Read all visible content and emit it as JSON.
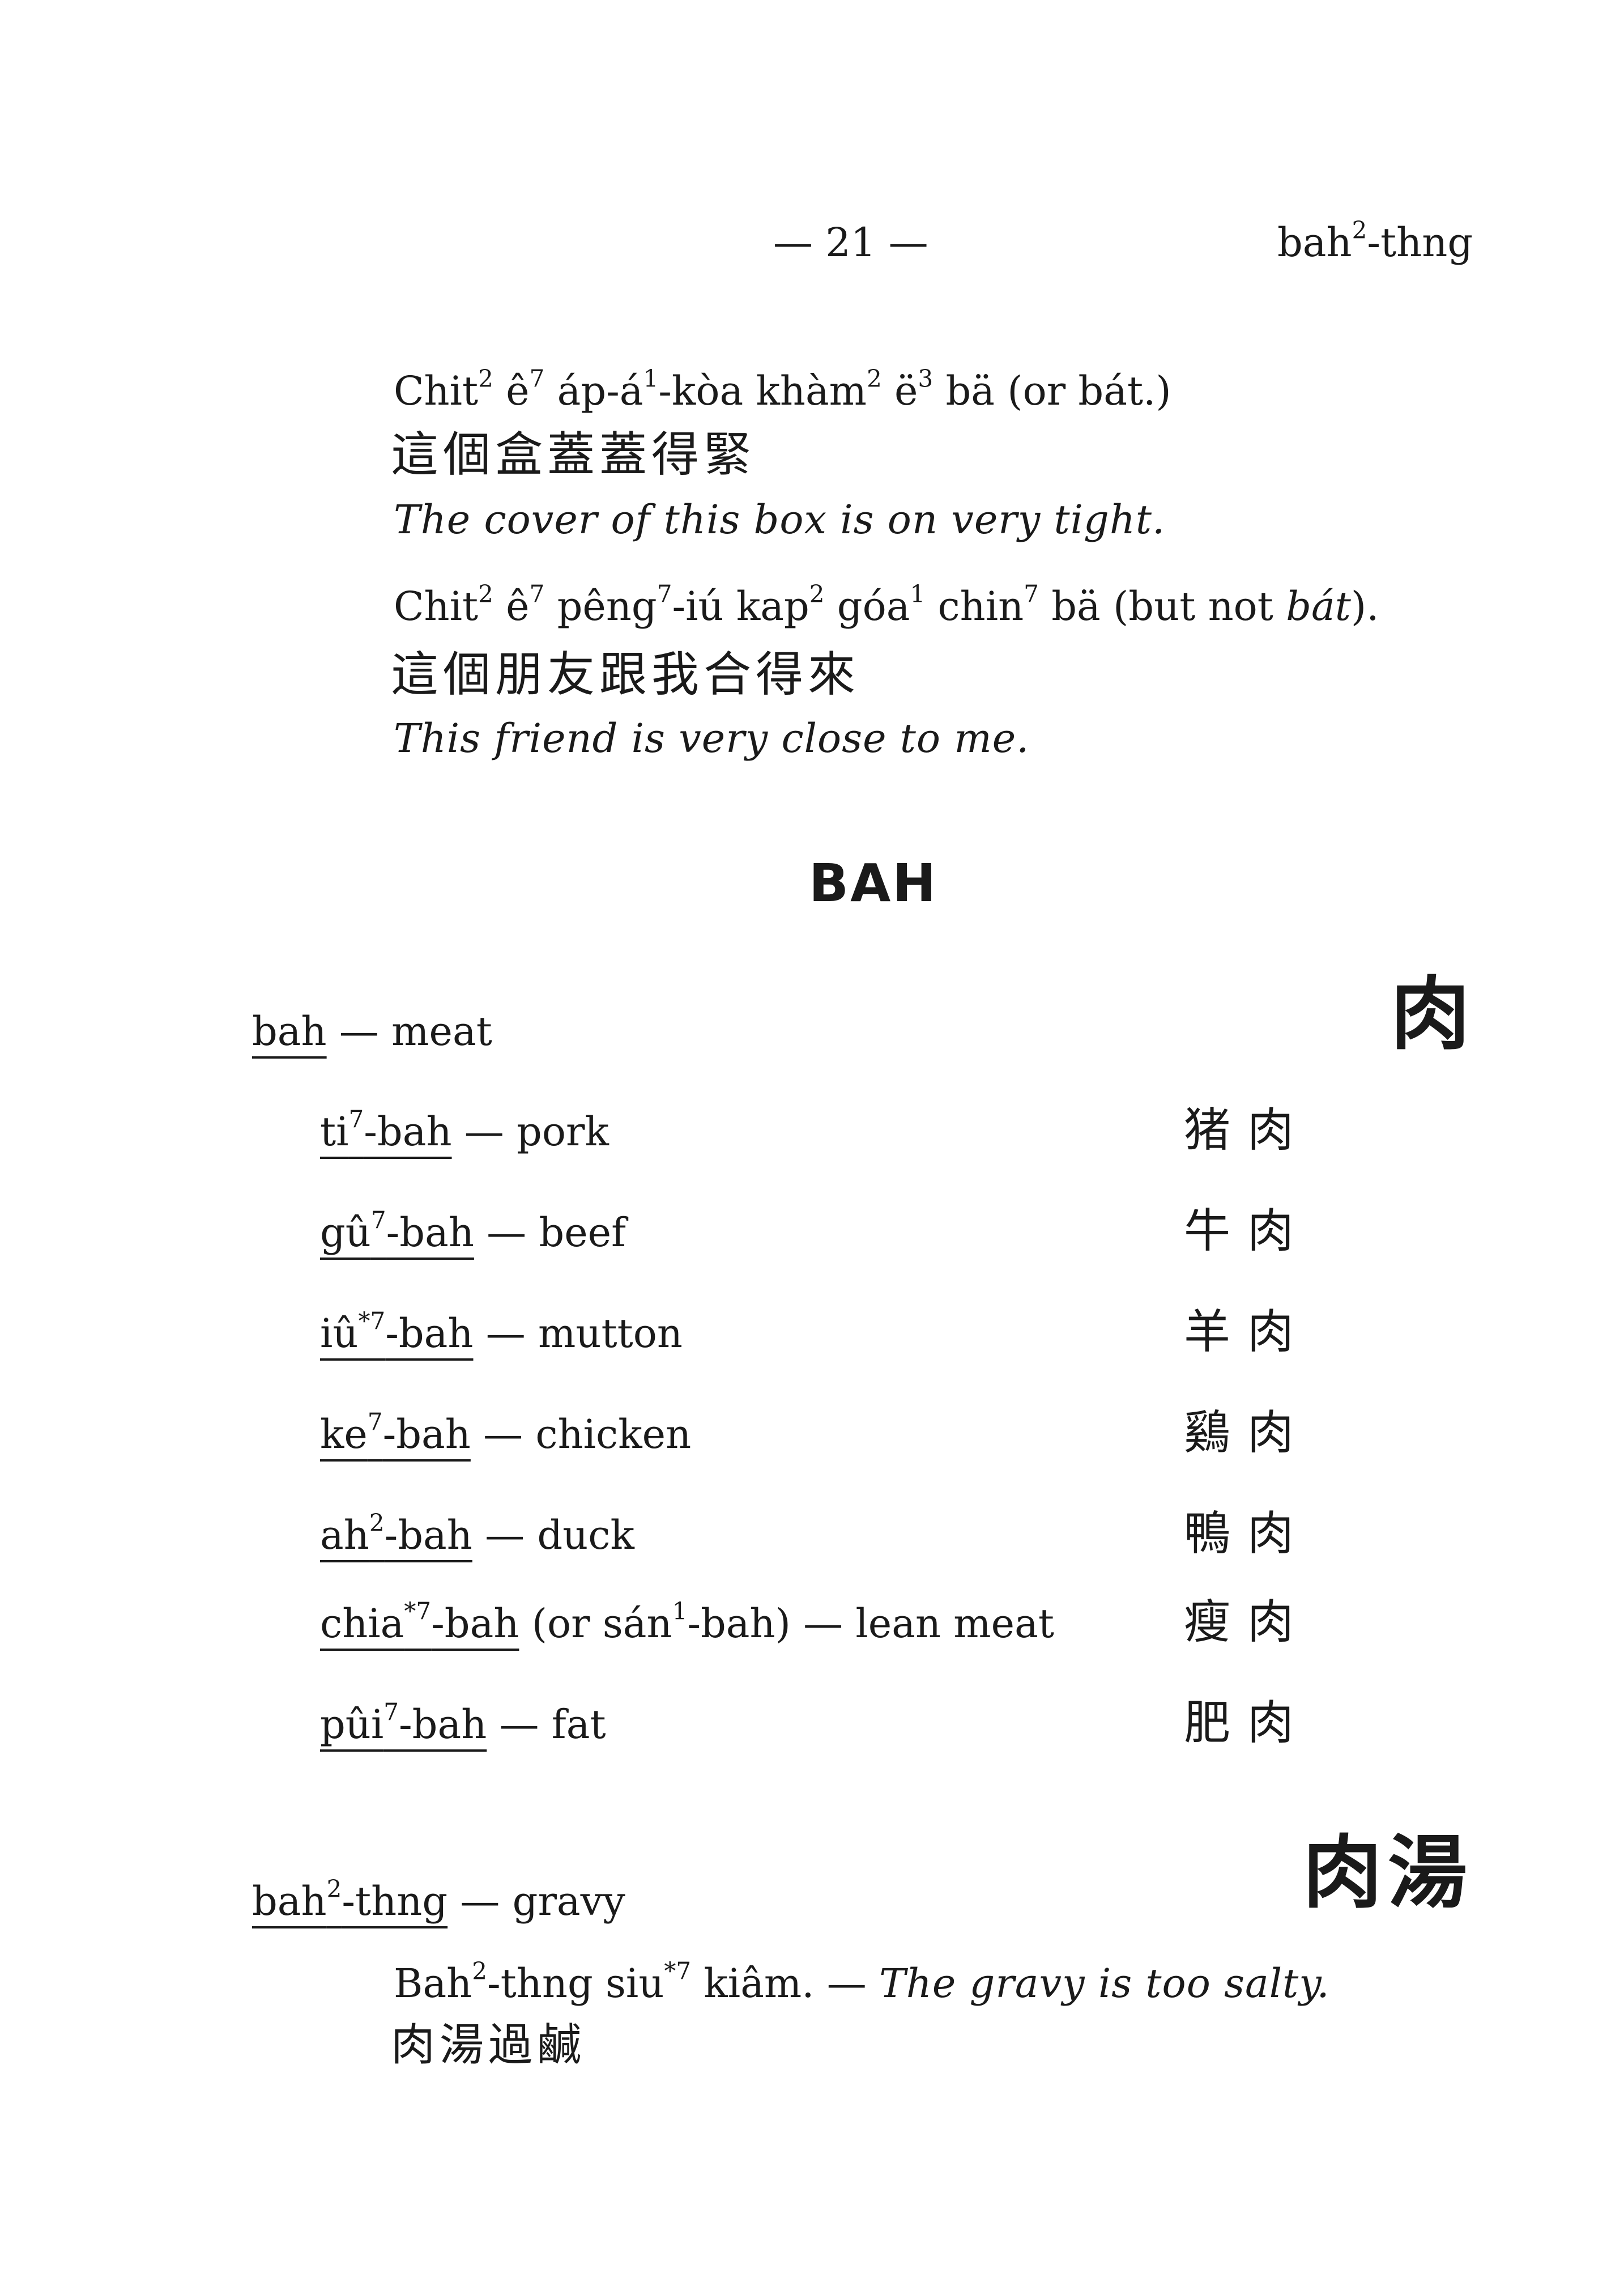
{
  "header": {
    "page_number": "— 21 —",
    "running_head": {
      "base": "bah",
      "sup": "2",
      "rest": "-thng"
    }
  },
  "examples_top": [
    {
      "rom_segments": [
        {
          "t": "Chit"
        },
        {
          "t": "2",
          "s": true
        },
        {
          "t": " ê"
        },
        {
          "t": "7",
          "s": true
        },
        {
          "t": " áp-á"
        },
        {
          "t": "1",
          "s": true
        },
        {
          "t": "-kòa khàm"
        },
        {
          "t": "2",
          "s": true
        },
        {
          "t": " ë"
        },
        {
          "t": "3",
          "s": true
        },
        {
          "t": " bä (or bát.)"
        }
      ],
      "chinese": "這個盒蓋蓋得緊",
      "english": "The cover of this box is on very tight."
    },
    {
      "rom_segments": [
        {
          "t": "Chit"
        },
        {
          "t": "2",
          "s": true
        },
        {
          "t": " ê"
        },
        {
          "t": "7",
          "s": true
        },
        {
          "t": " pêng"
        },
        {
          "t": "7",
          "s": true
        },
        {
          "t": "-iú kap"
        },
        {
          "t": "2",
          "s": true
        },
        {
          "t": " góa"
        },
        {
          "t": "1",
          "s": true
        },
        {
          "t": " chin"
        },
        {
          "t": "7",
          "s": true
        },
        {
          "t": " bä (but not "
        },
        {
          "t": "bát",
          "i": true
        },
        {
          "t": ")."
        }
      ],
      "chinese": "這個朋友跟我合得來",
      "english": "This friend is very close to me."
    }
  ],
  "section_heading": "BAH",
  "entry_bah": {
    "word": "bah",
    "dash": " — ",
    "gloss": "meat",
    "chinese": "肉"
  },
  "sub_entries": [
    {
      "word_segments": [
        {
          "t": "ti"
        },
        {
          "t": "7",
          "s": true
        },
        {
          "t": "-bah"
        }
      ],
      "rest": " — pork",
      "chinese": "猪肉"
    },
    {
      "word_segments": [
        {
          "t": "gû"
        },
        {
          "t": "7",
          "s": true
        },
        {
          "t": "-bah"
        }
      ],
      "rest": " — beef",
      "chinese": "牛肉"
    },
    {
      "word_segments": [
        {
          "t": "iû"
        },
        {
          "t": "*7",
          "s": true
        },
        {
          "t": "-bah"
        }
      ],
      "rest": " — mutton",
      "chinese": "羊肉"
    },
    {
      "word_segments": [
        {
          "t": "ke"
        },
        {
          "t": "7",
          "s": true
        },
        {
          "t": "-bah"
        }
      ],
      "rest": " — chicken",
      "chinese": "鷄肉"
    },
    {
      "word_segments": [
        {
          "t": "ah"
        },
        {
          "t": "2",
          "s": true
        },
        {
          "t": "-bah"
        }
      ],
      "rest": " — duck",
      "chinese": "鴨肉"
    },
    {
      "word_segments": [
        {
          "t": "chia"
        },
        {
          "t": "*7",
          "s": true
        },
        {
          "t": "-bah"
        }
      ],
      "rest_segments": [
        {
          "t": " (or sán"
        },
        {
          "t": "1",
          "s": true
        },
        {
          "t": "-bah) — lean meat"
        }
      ],
      "chinese": "瘦肉"
    },
    {
      "word_segments": [
        {
          "t": "pûi"
        },
        {
          "t": "7",
          "s": true
        },
        {
          "t": "-bah"
        }
      ],
      "rest": " — fat",
      "chinese": "肥肉"
    }
  ],
  "entry_gravy": {
    "word_segments": [
      {
        "t": "bah"
      },
      {
        "t": "2",
        "s": true
      },
      {
        "t": "-thng"
      }
    ],
    "dash": " — ",
    "gloss": "gravy",
    "chinese": "肉湯",
    "example": {
      "rom_segments": [
        {
          "t": "Bah"
        },
        {
          "t": "2",
          "s": true
        },
        {
          "t": "-thng siu"
        },
        {
          "t": "*7",
          "s": true
        },
        {
          "t": " kiâm. — "
        }
      ],
      "english": "The gravy is too salty.",
      "chinese": "肉湯過鹹"
    }
  }
}
